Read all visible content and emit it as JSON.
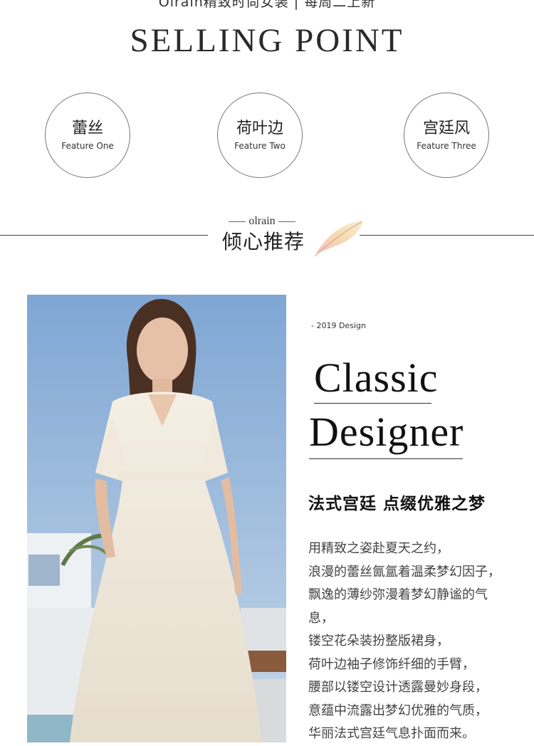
{
  "top_banner": "Olrain精致时尚女装 | 每周二上新",
  "headline": "SELLING POINT",
  "features": [
    {
      "cn": "蕾丝",
      "en": "Feature One"
    },
    {
      "cn": "荷叶边",
      "en": "Feature Two"
    },
    {
      "cn": "宫廷风",
      "en": "Feature Three"
    }
  ],
  "brand": "olrain",
  "section_title": "倾心推荐",
  "year_tag": "- 2019 Design",
  "word1": "Classic",
  "word2": "Designer",
  "tagline": "法式宫廷  点缀优雅之梦",
  "body": [
    "用精致之姿赴夏天之约，",
    "浪漫的蕾丝氤氲着温柔梦幻因子，",
    "飘逸的薄纱弥漫着梦幻静谧的气",
    "息，",
    "镂空花朵装扮整版裙身，",
    "荷叶边袖子修饰纤细的手臂，",
    "腰部以镂空设计透露曼妙身段，",
    "意蕴中流露出梦幻优雅的气质，",
    "华丽法式宫廷气息扑面而来。"
  ]
}
